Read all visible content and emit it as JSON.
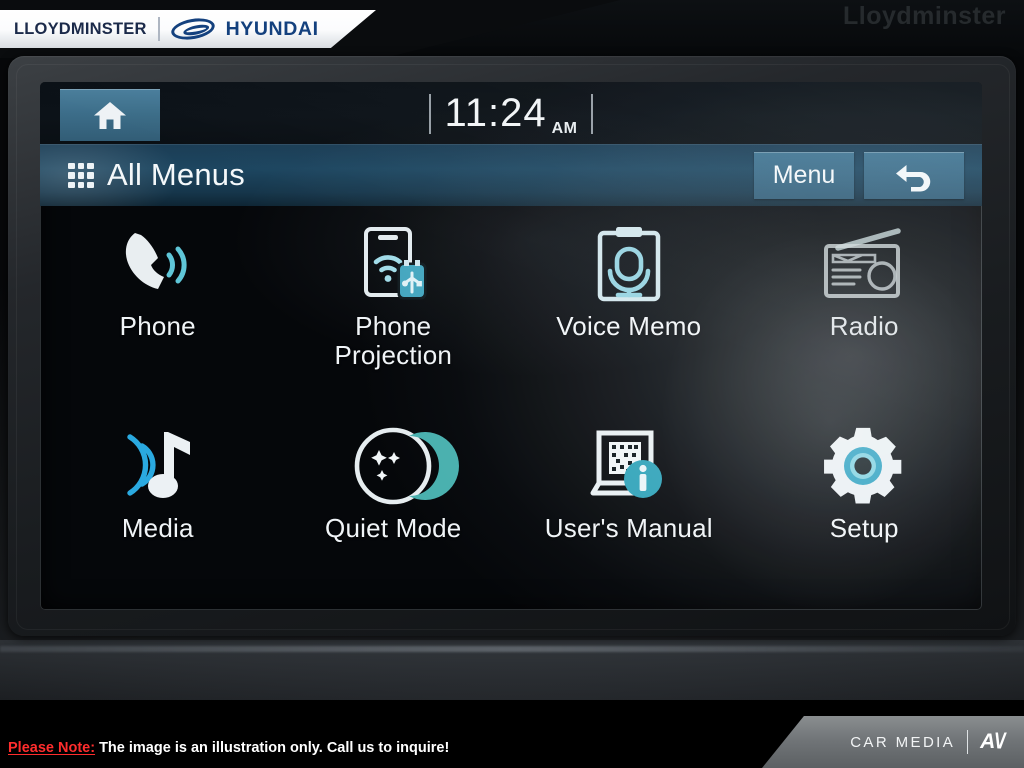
{
  "dealer_banner": {
    "dealer_name": "LLOYDMINSTER",
    "brand": "HYUNDAI",
    "logo_icon": "hyundai-logo-icon",
    "ghost_watermark": "Lloydminster"
  },
  "head_unit": {
    "status_bar": {
      "home_button_icon": "home-icon",
      "clock_time": "11:24",
      "clock_meridiem": "AM"
    },
    "title_bar": {
      "grid_icon": "grid-3x3-icon",
      "title": "All Menus",
      "menu_button_label": "Menu",
      "back_button_icon": "back-arrow-icon"
    },
    "menu_items": [
      {
        "label": "Phone",
        "icon": "phone-handset-icon",
        "enabled": true,
        "accent": "#5fc6d8"
      },
      {
        "label": "Phone\nProjection",
        "icon": "phone-projection-icon",
        "enabled": true,
        "accent": "#7fd4e2"
      },
      {
        "label": "Voice Memo",
        "icon": "voice-memo-icon",
        "enabled": true,
        "accent": "#a9dbe6"
      },
      {
        "label": "Radio",
        "icon": "radio-icon",
        "enabled": false,
        "accent": "#b9c6c9"
      },
      {
        "label": "Media",
        "icon": "music-note-icon",
        "enabled": true,
        "accent": "#2aa9e0"
      },
      {
        "label": "Quiet Mode",
        "icon": "quiet-mode-moon-icon",
        "enabled": true,
        "accent": "#55b7b7"
      },
      {
        "label": "User's Manual",
        "icon": "users-manual-qr-icon",
        "enabled": true,
        "accent": "#3aa9bd"
      },
      {
        "label": "Setup",
        "icon": "gear-icon",
        "enabled": true,
        "accent": "#44b4cf"
      }
    ]
  },
  "footer": {
    "note_label": "Please Note:",
    "note_text": " The image is an illustration only. Call us to inquire!",
    "watermark_text": "CAR MEDIA",
    "watermark_mark": "A\\/"
  },
  "colors": {
    "brand_blue": "#14417e",
    "ui_accent_teal": "#4fb8cc",
    "titlebar_blue": "#1d4660",
    "button_blue": "#38698e",
    "note_red": "#ff2d2d"
  }
}
